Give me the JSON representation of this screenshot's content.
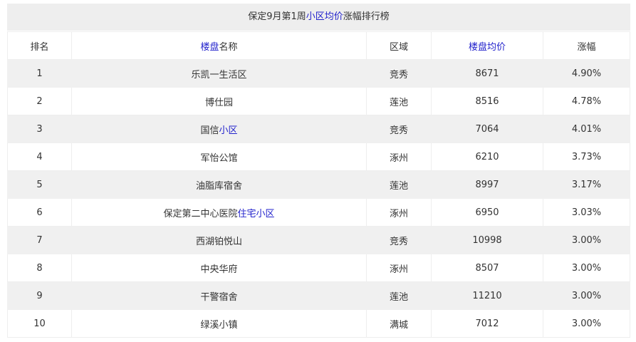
{
  "caption": {
    "prefix": "保定9月第1周",
    "link": "小区均价",
    "suffix": "涨幅排行榜"
  },
  "headers": {
    "rank": "排名",
    "name_link": "楼盘",
    "name_rest": "名称",
    "area": "区域",
    "price": "楼盘均价",
    "change": "涨幅"
  },
  "rows": [
    {
      "rank": "1",
      "name": "乐凯一生活区",
      "name_link": "",
      "area": "竞秀",
      "price": "8671",
      "change": "4.90%"
    },
    {
      "rank": "2",
      "name": "博仕园",
      "name_link": "",
      "area": "莲池",
      "price": "8516",
      "change": "4.78%"
    },
    {
      "rank": "3",
      "name": "国信",
      "name_link": "小区",
      "area": "竞秀",
      "price": "7064",
      "change": "4.01%"
    },
    {
      "rank": "4",
      "name": "军怡公馆",
      "name_link": "",
      "area": "涿州",
      "price": "6210",
      "change": "3.73%"
    },
    {
      "rank": "5",
      "name": "油脂库宿舍",
      "name_link": "",
      "area": "莲池",
      "price": "8997",
      "change": "3.17%"
    },
    {
      "rank": "6",
      "name": "保定第二中心医院",
      "name_link": "住宅小区",
      "area": "涿州",
      "price": "6950",
      "change": "3.03%"
    },
    {
      "rank": "7",
      "name": "西湖铂悦山",
      "name_link": "",
      "area": "竞秀",
      "price": "10998",
      "change": "3.00%"
    },
    {
      "rank": "8",
      "name": "中央华府",
      "name_link": "",
      "area": "涿州",
      "price": "8507",
      "change": "3.00%"
    },
    {
      "rank": "9",
      "name": "干警宿舍",
      "name_link": "",
      "area": "莲池",
      "price": "11210",
      "change": "3.00%"
    },
    {
      "rank": "10",
      "name": "绿溪小镇",
      "name_link": "",
      "area": "满城",
      "price": "7012",
      "change": "3.00%"
    }
  ],
  "colors": {
    "link": "#2222cc",
    "stripe": "#f0f0f0",
    "caption_bg": "#eeeeee",
    "text": "#333333"
  }
}
